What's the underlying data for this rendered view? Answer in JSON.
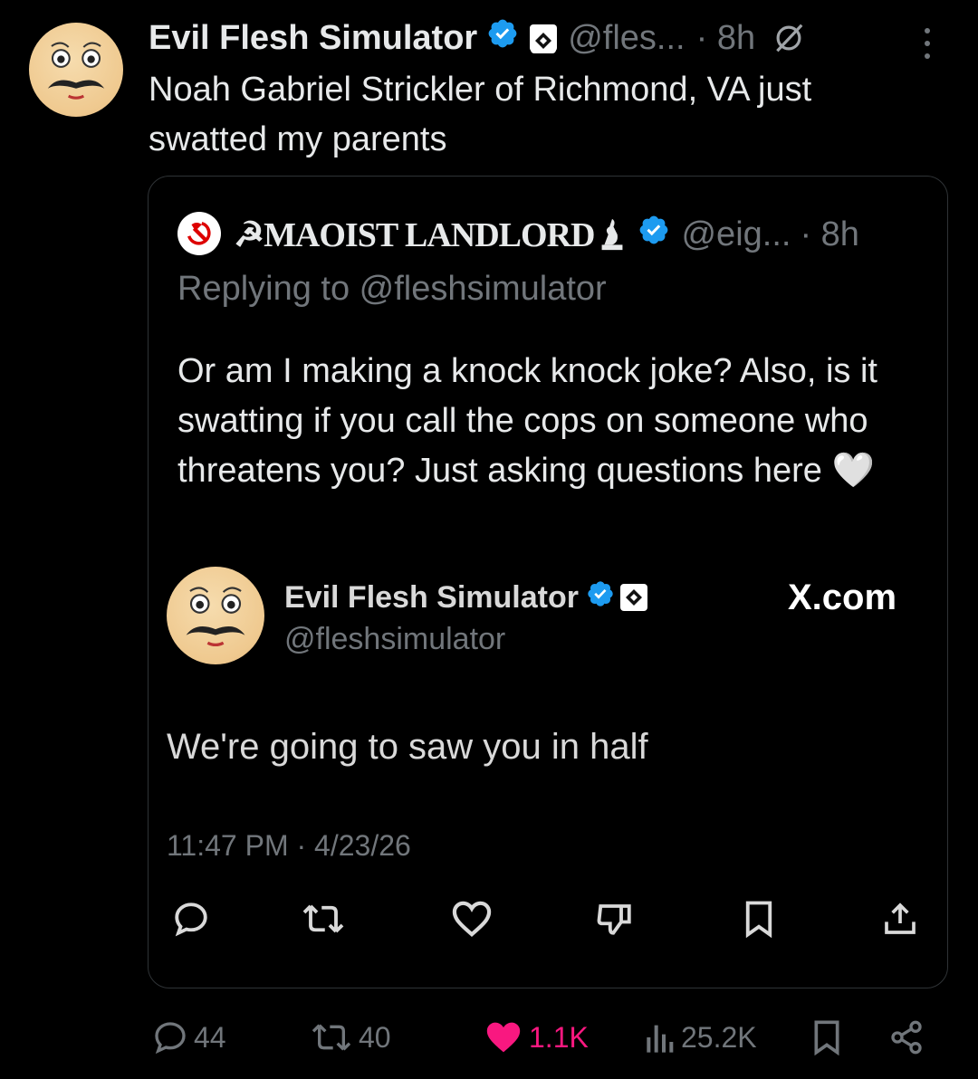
{
  "post": {
    "author_name": "Evil Flesh Simulator",
    "handle": "@fles...",
    "time": "· 8h",
    "text": "Noah Gabriel Strickler of Richmond, VA just swatted my parents",
    "icons": {
      "avatar": "moustache-face-avatar",
      "verified": "verified-badge-icon",
      "affiliation": "affiliation-badge-icon",
      "grok": "grok-icon",
      "more": "more-vertical-icon"
    }
  },
  "quote": {
    "author_name": "☭MAOIST LANDLORD",
    "handle": "@eig...",
    "time": "· 8h",
    "replying_prefix": "Replying to ",
    "replying_handle": "@fleshsimulator",
    "text": "Or am I making a knock knock joke? Also, is it swatting if you call the cops on someone who threatens you? Just asking questions here 🤍",
    "icons": {
      "avatar": "hammer-sickle-avatar",
      "name_emoji": "bird-statue-icon",
      "verified": "verified-badge-icon"
    }
  },
  "embedded": {
    "author_name": "Evil Flesh Simulator",
    "handle": "@fleshsimulator",
    "brand": "X.com",
    "text": "We're going to saw you in half",
    "timestamp": "11:47 PM · 4/23/26",
    "actions": [
      "reply-icon",
      "retweet-icon",
      "like-icon",
      "dislike-icon",
      "bookmark-icon",
      "share-icon"
    ]
  },
  "stats": {
    "replies": "44",
    "reposts": "40",
    "likes": "1.1K",
    "views": "25.2K",
    "like_color": "#f91880",
    "accent_color": "#1d9bf0"
  }
}
